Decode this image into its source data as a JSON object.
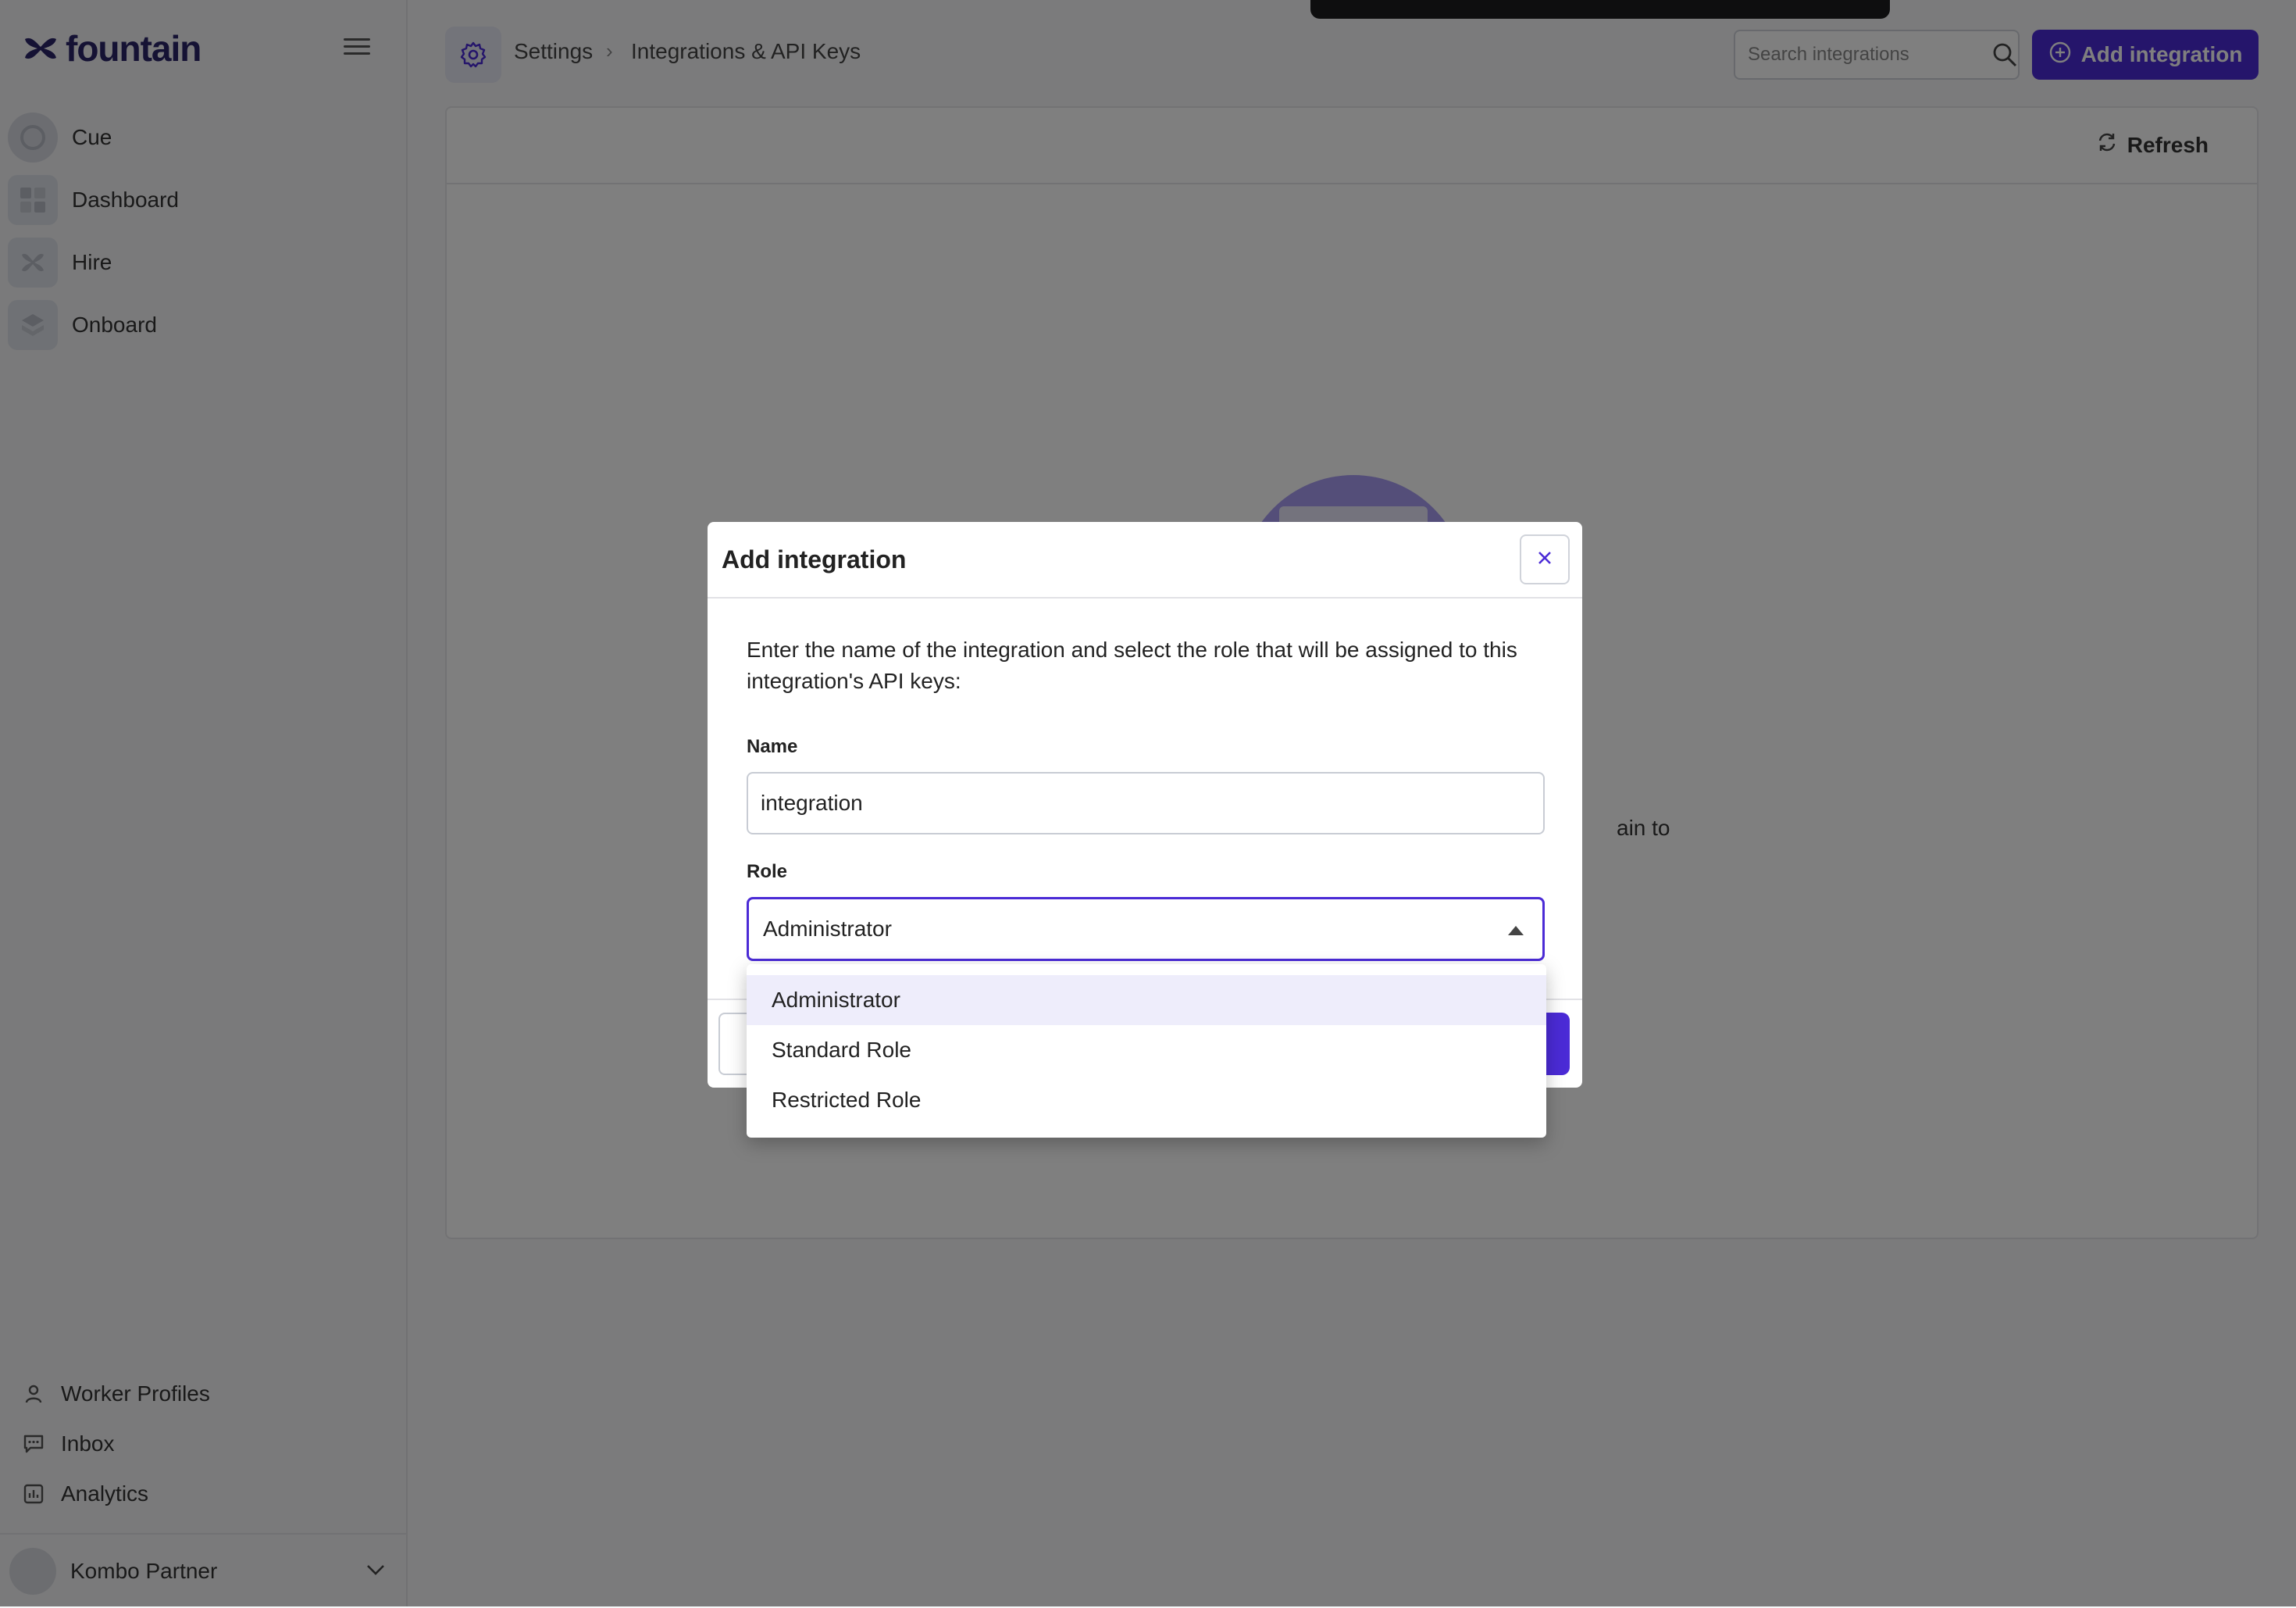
{
  "app": {
    "name": "fountain"
  },
  "sidebar": {
    "items": [
      {
        "label": "Cue",
        "icon": "cue-icon"
      },
      {
        "label": "Dashboard",
        "icon": "dashboard-icon"
      },
      {
        "label": "Hire",
        "icon": "hire-icon"
      },
      {
        "label": "Onboard",
        "icon": "onboard-icon"
      }
    ],
    "bottom_items": [
      {
        "label": "Worker Profiles",
        "icon": "person-icon"
      },
      {
        "label": "Inbox",
        "icon": "chat-icon"
      },
      {
        "label": "Analytics",
        "icon": "bar-chart-icon"
      }
    ],
    "account": {
      "name": "Kombo Partner"
    }
  },
  "header": {
    "breadcrumb": [
      "Settings",
      "Integrations & API Keys"
    ],
    "search_placeholder": "Search integrations",
    "add_button_label": "Add integration"
  },
  "panel": {
    "refresh_label": "Refresh",
    "partial_text": "ain to"
  },
  "modal": {
    "title": "Add integration",
    "description": "Enter the name of the integration and select the role that will be assigned to this integration's API keys:",
    "name_label": "Name",
    "name_value": "integration",
    "role_label": "Role",
    "role_value": "Administrator",
    "role_options": [
      "Administrator",
      "Standard Role",
      "Restricted Role"
    ]
  },
  "colors": {
    "accent": "#4b2bd6",
    "brand_text": "#2a2469"
  }
}
